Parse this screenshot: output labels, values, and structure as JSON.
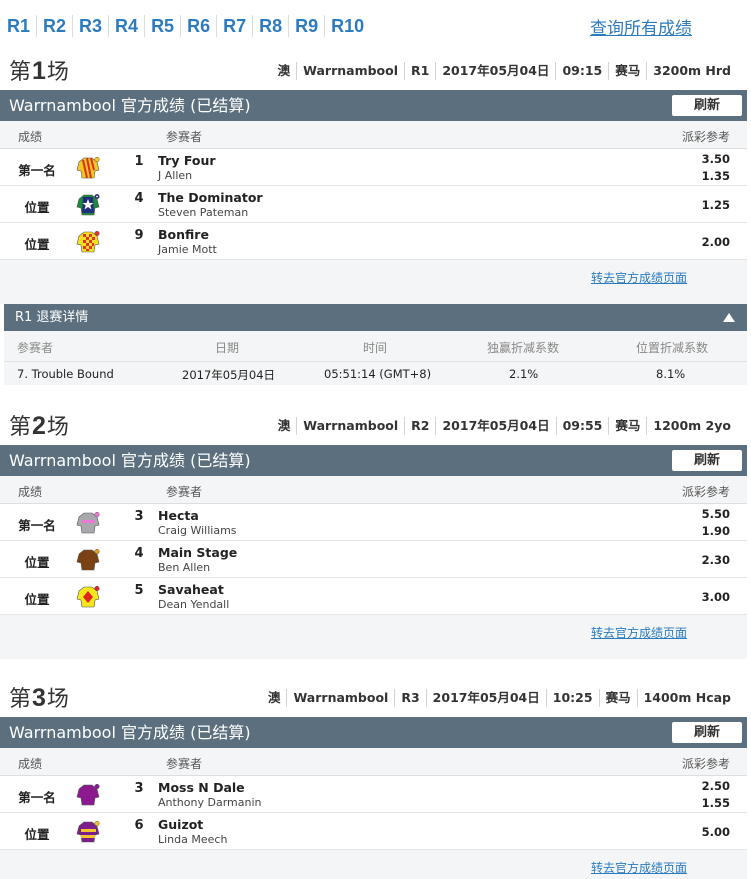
{
  "nav": {
    "races": [
      "R1",
      "R2",
      "R3",
      "R4",
      "R5",
      "R6",
      "R7",
      "R8",
      "R9",
      "R10"
    ],
    "all_results": "查询所有成绩"
  },
  "labels": {
    "results_bar_suffix": "官方成绩 (已结算)",
    "refresh": "刷新",
    "col_result": "成绩",
    "col_runner": "参赛者",
    "col_dividend": "派彩参考",
    "official_link": "转去官方成绩页面"
  },
  "races": [
    {
      "title_prefix": "第",
      "title_num": "1",
      "title_suffix": "场",
      "meta": [
        "澳",
        "Warrnambool",
        "R1",
        "2017年05月04日",
        "09:15",
        "赛马",
        "3200m Hrd"
      ],
      "venue": "Warrnambool",
      "results": [
        {
          "place": "第一名",
          "num": "1",
          "horse": "Try Four",
          "jockey": "J Allen",
          "div1": "3.50",
          "div2": "1.35",
          "silk": "red-yellow-stripes"
        },
        {
          "place": "位置",
          "num": "4",
          "horse": "The Dominator",
          "jockey": "Steven Pateman",
          "div1": "1.25",
          "div2": "",
          "silk": "green-navy-star"
        },
        {
          "place": "位置",
          "num": "9",
          "horse": "Bonfire",
          "jockey": "Jamie Mott",
          "div1": "2.00",
          "div2": "",
          "silk": "red-yellow-checks"
        }
      ]
    },
    {
      "title_prefix": "第",
      "title_num": "2",
      "title_suffix": "场",
      "meta": [
        "澳",
        "Warrnambool",
        "R2",
        "2017年05月04日",
        "09:55",
        "赛马",
        "1200m 2yo"
      ],
      "venue": "Warrnambool",
      "results": [
        {
          "place": "第一名",
          "num": "3",
          "horse": "Hecta",
          "jockey": "Craig Williams",
          "div1": "5.50",
          "div2": "1.90",
          "silk": "grey-pink"
        },
        {
          "place": "位置",
          "num": "4",
          "horse": "Main Stage",
          "jockey": "Ben Allen",
          "div1": "2.30",
          "div2": "",
          "silk": "brown"
        },
        {
          "place": "位置",
          "num": "5",
          "horse": "Savaheat",
          "jockey": "Dean Yendall",
          "div1": "3.00",
          "div2": "",
          "silk": "yellow-red-diamond"
        }
      ]
    },
    {
      "title_prefix": "第",
      "title_num": "3",
      "title_suffix": "场",
      "meta": [
        "澳",
        "Warrnambool",
        "R3",
        "2017年05月04日",
        "10:25",
        "赛马",
        "1400m Hcap"
      ],
      "venue": "Warrnambool",
      "results": [
        {
          "place": "第一名",
          "num": "3",
          "horse": "Moss N Dale",
          "jockey": "Anthony Darmanin",
          "div1": "2.50",
          "div2": "1.55",
          "silk": "purple"
        },
        {
          "place": "位置",
          "num": "6",
          "horse": "Guizot",
          "jockey": "Linda Meech",
          "div1": "5.00",
          "div2": "",
          "silk": "purple-yellow"
        }
      ]
    }
  ],
  "scratch": {
    "title": "R1 退赛详情",
    "headers": [
      "参赛者",
      "日期",
      "时间",
      "独赢折减系数",
      "位置折减系数"
    ],
    "rows": [
      [
        "7. Trouble Bound",
        "2017年05月04日",
        "05:51:14 (GMT+8)",
        "2.1%",
        "8.1%"
      ]
    ]
  }
}
